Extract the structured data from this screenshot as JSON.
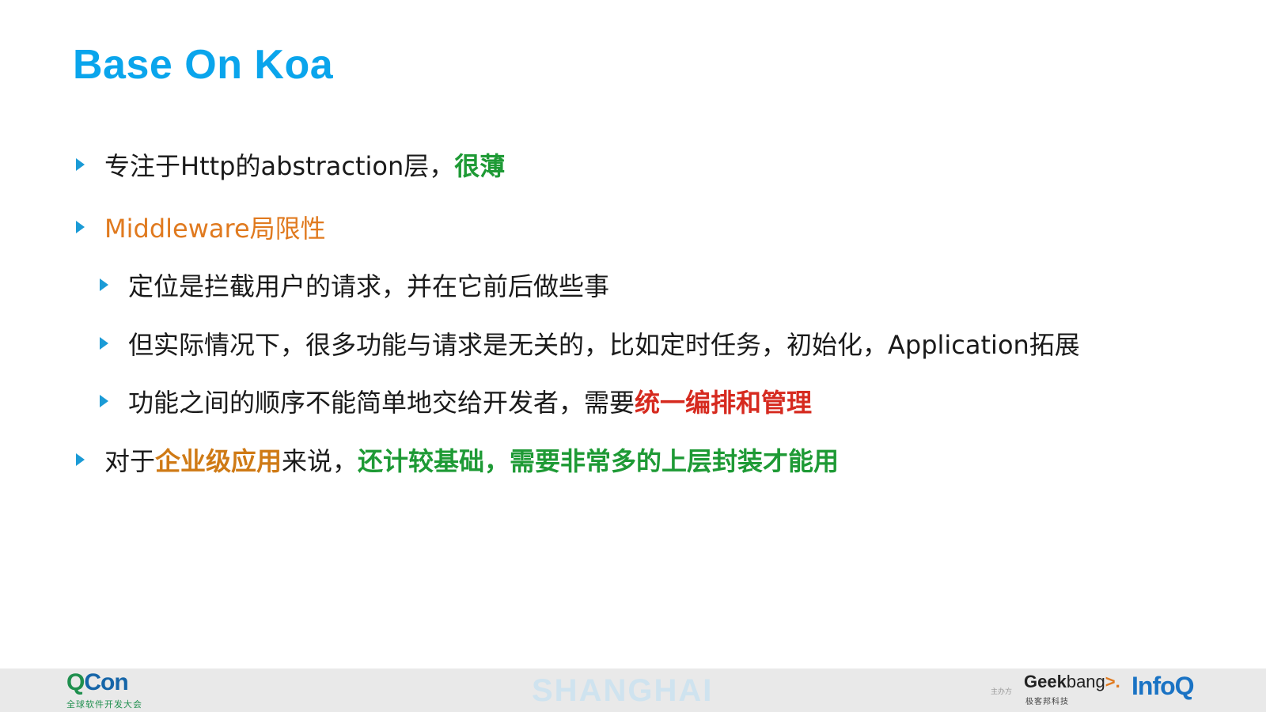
{
  "slide": {
    "title": "Base On Koa",
    "bullets": {
      "b1": {
        "text": "专注于Http的abstraction层，",
        "highlight": "很薄"
      },
      "b2": {
        "text": "Middleware局限性"
      },
      "b2a": {
        "text": "定位是拦截用户的请求，并在它前后做些事"
      },
      "b2b": {
        "text": "但实际情况下，很多功能与请求是无关的，比如定时任务，初始化，Application拓展"
      },
      "b2c": {
        "text": "功能之间的顺序不能简单地交给开发者，需要",
        "highlight": "统一编排和管理"
      },
      "b3": {
        "prefix": "对于",
        "highlight1": "企业级应用",
        "middle": "来说，",
        "highlight2": "还计较基础，需要非常多的上层封装才能用"
      }
    }
  },
  "footer": {
    "qcon_q": "Q",
    "qcon_con": "Con",
    "qcon_sub": "全球软件开发大会",
    "city": "SHANGHAI",
    "organizer_label": "主办方",
    "geek": "Geek",
    "bang": "bang",
    "bang_arrow": ">.",
    "geek_sub": "极客邦科技",
    "infoq": "InfoQ"
  },
  "colors": {
    "title": "#0aa5ec",
    "marker": "#1b9bd6",
    "orange": "#e07a1f",
    "green": "#1e9a35",
    "red": "#d62a1f",
    "brown": "#cf7a15",
    "footer_bg": "#e9e9e9"
  },
  "icons": {
    "bullet_marker": "right-triangle-icon"
  }
}
